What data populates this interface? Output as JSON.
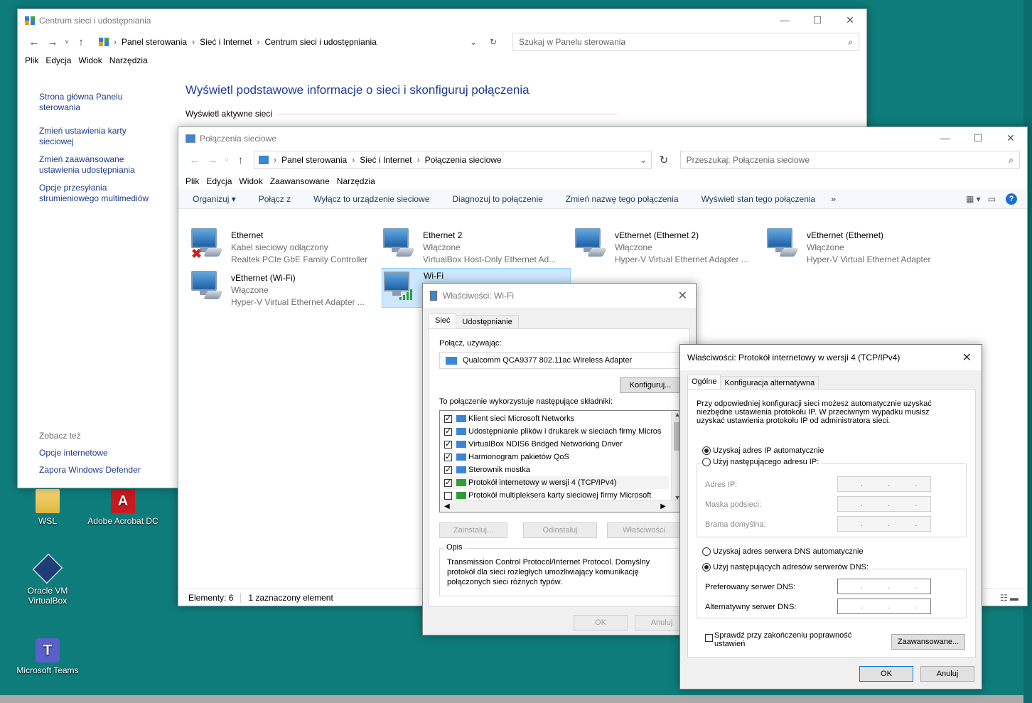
{
  "desktop": {
    "icons": [
      {
        "label": "WSL",
        "icon": "folder-icon"
      },
      {
        "label": "Adobe Acrobat DC",
        "icon": "acrobat-icon"
      },
      {
        "label": "Oracle VM VirtualBox",
        "icon": "virtualbox-icon"
      },
      {
        "label": "Microsoft Teams",
        "icon": "teams-icon"
      }
    ]
  },
  "network_center": {
    "title": "Centrum sieci i udostępniania",
    "breadcrumb": [
      "Panel sterowania",
      "Sieć i Internet",
      "Centrum sieci i udostępniania"
    ],
    "search_placeholder": "Szukaj w Panelu sterowania",
    "menu": [
      "Plik",
      "Edycja",
      "Widok",
      "Narzędzia"
    ],
    "sidebar": [
      "Strona główna Panelu sterowania",
      "Zmień ustawienia karty sieciowej",
      "Zmień zaawansowane ustawienia udostępniania",
      "Opcje przesyłania strumieniowego multimediów"
    ],
    "see_also_header": "Zobacz też",
    "see_also": [
      "Opcje internetowe",
      "Zapora Windows Defender"
    ],
    "heading": "Wyświetl podstawowe informacje o sieci i skonfiguruj połączenia",
    "active_networks": "Wyświetl aktywne sieci"
  },
  "connections": {
    "title": "Połączenia sieciowe",
    "breadcrumb": [
      "Panel sterowania",
      "Sieć i Internet",
      "Połączenia sieciowe"
    ],
    "search_placeholder": "Przeszukaj: Połączenia sieciowe",
    "menu": [
      "Plik",
      "Edycja",
      "Widok",
      "Zaawansowane",
      "Narzędzia"
    ],
    "toolbar": [
      "Organizuj ▾",
      "Połącz z",
      "Wyłącz to urządzenie sieciowe",
      "Diagnozuj to połączenie",
      "Zmień nazwę tego połączenia",
      "Wyświetl stan tego połączenia",
      "»"
    ],
    "adapters": [
      {
        "name": "Ethernet",
        "status": "Kabel sieciowy odłączony",
        "device": "Realtek PCIe GbE Family Controller"
      },
      {
        "name": "Ethernet 2",
        "status": "Włączone",
        "device": "VirtualBox Host-Only Ethernet Ad..."
      },
      {
        "name": "vEthernet (Ethernet 2)",
        "status": "Włączone",
        "device": "Hyper-V Virtual Ethernet Adapter ..."
      },
      {
        "name": "vEthernet (Ethernet)",
        "status": "Włączone",
        "device": "Hyper-V Virtual Ethernet Adapter"
      },
      {
        "name": "vEthernet (Wi-Fi)",
        "status": "Włączone",
        "device": "Hyper-V Virtual Ethernet Adapter ..."
      },
      {
        "name": "Wi-Fi",
        "status": "",
        "device": ""
      }
    ],
    "statusbar": {
      "count": "Elementy: 6",
      "selected": "1 zaznaczony element"
    }
  },
  "wifi_props": {
    "title": "Właściwości: Wi-Fi",
    "tabs": [
      "Sieć",
      "Udostępnianie"
    ],
    "connect_using_label": "Połącz, używając:",
    "adapter": "Qualcomm QCA9377 802.11ac Wireless Adapter",
    "configure_button": "Konfiguruj...",
    "components_label": "To połączenie wykorzystuje następujące składniki:",
    "components": [
      {
        "label": "Klient sieci Microsoft Networks",
        "checked": true
      },
      {
        "label": "Udostępnianie plików i drukarek w sieciach firmy Micros",
        "checked": true
      },
      {
        "label": "VirtualBox NDIS6 Bridged Networking Driver",
        "checked": true
      },
      {
        "label": "Harmonogram pakietów QoS",
        "checked": true
      },
      {
        "label": "Sterownik mostka",
        "checked": true
      },
      {
        "label": "Protokół internetowy w wersji 4 (TCP/IPv4)",
        "checked": true
      },
      {
        "label": "Protokół multipleksera karty sieciowej firmy Microsoft",
        "checked": false
      }
    ],
    "buttons": {
      "install": "Zainstaluj...",
      "uninstall": "Odinstaluj",
      "properties": "Właściwości",
      "ok": "OK",
      "cancel": "Anuluj"
    },
    "description_label": "Opis",
    "description": "Transmission Control Protocol/Internet Protocol. Domyślny protokół dla sieci rozległych umożliwiający komunikację połączonych sieci różnych typów."
  },
  "ipv4_props": {
    "title": "Właściwości: Protokół internetowy w wersji 4 (TCP/IPv4)",
    "tabs": [
      "Ogólne",
      "Konfiguracja alternatywna"
    ],
    "intro": "Przy odpowiedniej konfiguracji sieci możesz automatycznie uzyskać niezbędne ustawienia protokołu IP. W przeciwnym wypadku musisz uzyskać ustawienia protokołu IP od administratora sieci.",
    "auto_ip": "Uzyskaj adres IP automatycznie",
    "manual_ip": "Użyj następującego adresu IP:",
    "ip_label": "Adres IP:",
    "mask_label": "Maska podsieci:",
    "gateway_label": "Brama domyślna:",
    "auto_dns": "Uzyskaj adres serwera DNS automatycznie",
    "manual_dns": "Użyj następujących adresów serwerów DNS:",
    "preferred_dns": "Preferowany serwer DNS:",
    "alternate_dns": "Alternatywny serwer DNS:",
    "ip_dots": ". . .",
    "validate_label": "Sprawdź przy zakończeniu poprawność ustawień",
    "advanced_button": "Zaawansowane...",
    "ok_button": "OK",
    "cancel_button": "Anuluj"
  }
}
